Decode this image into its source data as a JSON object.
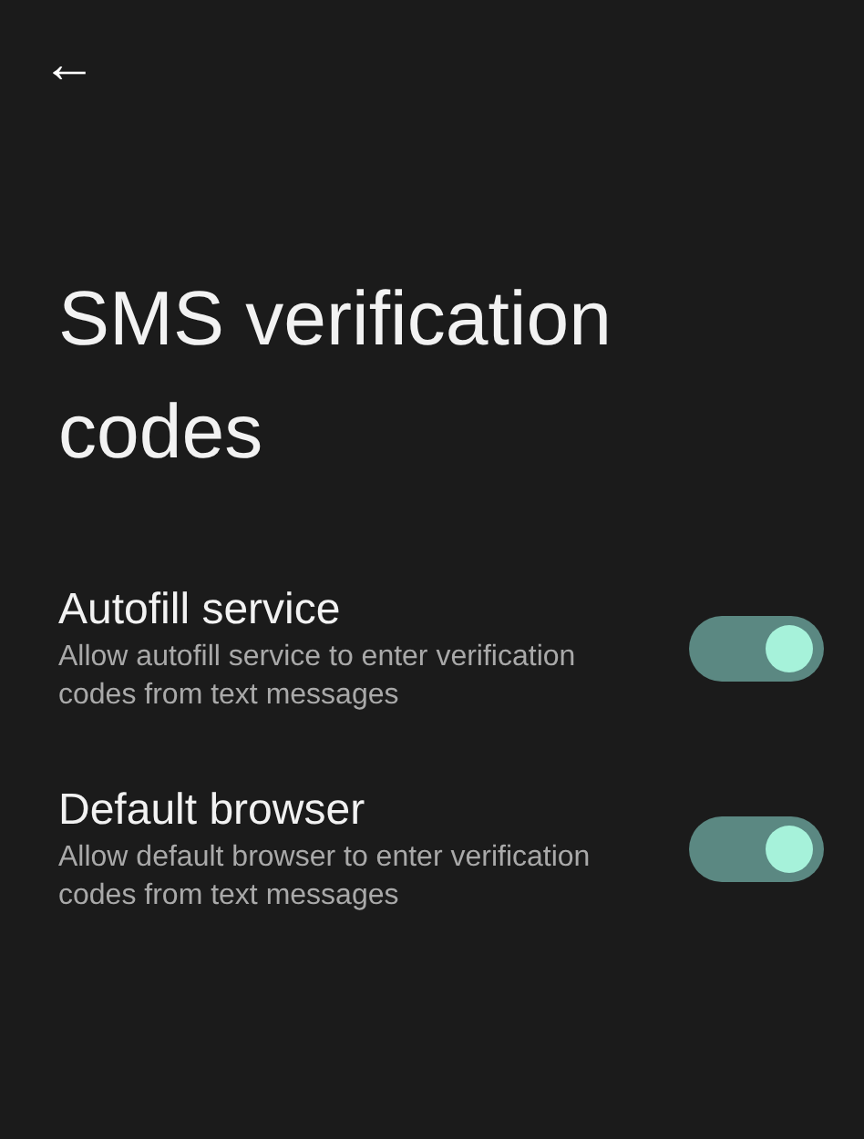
{
  "back_button": {
    "glyph": "←"
  },
  "title": "SMS verification codes",
  "settings": [
    {
      "label": "Autofill service",
      "description": "Allow autofill service to enter verification codes from text messages",
      "on": true
    },
    {
      "label": "Default browser",
      "description": "Allow default browser to enter verification codes from text messages",
      "on": true
    }
  ]
}
